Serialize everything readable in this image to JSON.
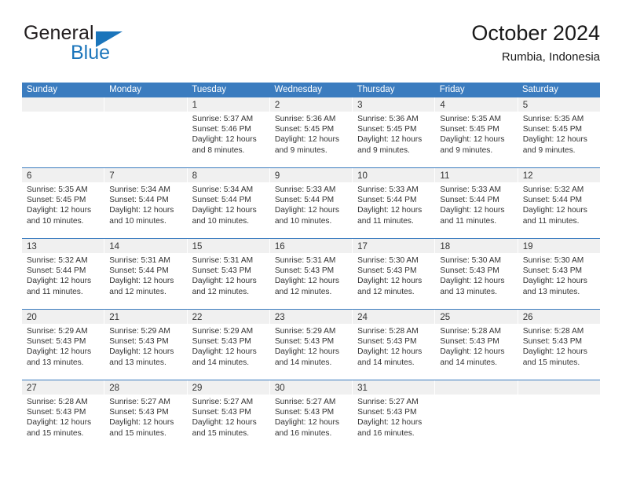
{
  "brand": {
    "name_top": "General",
    "name_bottom": "Blue",
    "triangle_icon": "triangle-icon",
    "color_blue": "#1b75bb",
    "color_dark": "#231f20"
  },
  "header": {
    "title": "October 2024",
    "subtitle": "Rumbia, Indonesia"
  },
  "theme": {
    "header_bg": "#3b7cbf",
    "header_text": "#ffffff",
    "day_band_bg": "#f0f0f0",
    "body_text": "#333333"
  },
  "weekdays": [
    "Sunday",
    "Monday",
    "Tuesday",
    "Wednesday",
    "Thursday",
    "Friday",
    "Saturday"
  ],
  "weeks": [
    [
      {
        "day": "",
        "sunrise": "",
        "sunset": "",
        "daylight_line1": "",
        "daylight_line2": ""
      },
      {
        "day": "",
        "sunrise": "",
        "sunset": "",
        "daylight_line1": "",
        "daylight_line2": ""
      },
      {
        "day": "1",
        "sunrise": "Sunrise: 5:37 AM",
        "sunset": "Sunset: 5:46 PM",
        "daylight_line1": "Daylight: 12 hours",
        "daylight_line2": "and 8 minutes."
      },
      {
        "day": "2",
        "sunrise": "Sunrise: 5:36 AM",
        "sunset": "Sunset: 5:45 PM",
        "daylight_line1": "Daylight: 12 hours",
        "daylight_line2": "and 9 minutes."
      },
      {
        "day": "3",
        "sunrise": "Sunrise: 5:36 AM",
        "sunset": "Sunset: 5:45 PM",
        "daylight_line1": "Daylight: 12 hours",
        "daylight_line2": "and 9 minutes."
      },
      {
        "day": "4",
        "sunrise": "Sunrise: 5:35 AM",
        "sunset": "Sunset: 5:45 PM",
        "daylight_line1": "Daylight: 12 hours",
        "daylight_line2": "and 9 minutes."
      },
      {
        "day": "5",
        "sunrise": "Sunrise: 5:35 AM",
        "sunset": "Sunset: 5:45 PM",
        "daylight_line1": "Daylight: 12 hours",
        "daylight_line2": "and 9 minutes."
      }
    ],
    [
      {
        "day": "6",
        "sunrise": "Sunrise: 5:35 AM",
        "sunset": "Sunset: 5:45 PM",
        "daylight_line1": "Daylight: 12 hours",
        "daylight_line2": "and 10 minutes."
      },
      {
        "day": "7",
        "sunrise": "Sunrise: 5:34 AM",
        "sunset": "Sunset: 5:44 PM",
        "daylight_line1": "Daylight: 12 hours",
        "daylight_line2": "and 10 minutes."
      },
      {
        "day": "8",
        "sunrise": "Sunrise: 5:34 AM",
        "sunset": "Sunset: 5:44 PM",
        "daylight_line1": "Daylight: 12 hours",
        "daylight_line2": "and 10 minutes."
      },
      {
        "day": "9",
        "sunrise": "Sunrise: 5:33 AM",
        "sunset": "Sunset: 5:44 PM",
        "daylight_line1": "Daylight: 12 hours",
        "daylight_line2": "and 10 minutes."
      },
      {
        "day": "10",
        "sunrise": "Sunrise: 5:33 AM",
        "sunset": "Sunset: 5:44 PM",
        "daylight_line1": "Daylight: 12 hours",
        "daylight_line2": "and 11 minutes."
      },
      {
        "day": "11",
        "sunrise": "Sunrise: 5:33 AM",
        "sunset": "Sunset: 5:44 PM",
        "daylight_line1": "Daylight: 12 hours",
        "daylight_line2": "and 11 minutes."
      },
      {
        "day": "12",
        "sunrise": "Sunrise: 5:32 AM",
        "sunset": "Sunset: 5:44 PM",
        "daylight_line1": "Daylight: 12 hours",
        "daylight_line2": "and 11 minutes."
      }
    ],
    [
      {
        "day": "13",
        "sunrise": "Sunrise: 5:32 AM",
        "sunset": "Sunset: 5:44 PM",
        "daylight_line1": "Daylight: 12 hours",
        "daylight_line2": "and 11 minutes."
      },
      {
        "day": "14",
        "sunrise": "Sunrise: 5:31 AM",
        "sunset": "Sunset: 5:44 PM",
        "daylight_line1": "Daylight: 12 hours",
        "daylight_line2": "and 12 minutes."
      },
      {
        "day": "15",
        "sunrise": "Sunrise: 5:31 AM",
        "sunset": "Sunset: 5:43 PM",
        "daylight_line1": "Daylight: 12 hours",
        "daylight_line2": "and 12 minutes."
      },
      {
        "day": "16",
        "sunrise": "Sunrise: 5:31 AM",
        "sunset": "Sunset: 5:43 PM",
        "daylight_line1": "Daylight: 12 hours",
        "daylight_line2": "and 12 minutes."
      },
      {
        "day": "17",
        "sunrise": "Sunrise: 5:30 AM",
        "sunset": "Sunset: 5:43 PM",
        "daylight_line1": "Daylight: 12 hours",
        "daylight_line2": "and 12 minutes."
      },
      {
        "day": "18",
        "sunrise": "Sunrise: 5:30 AM",
        "sunset": "Sunset: 5:43 PM",
        "daylight_line1": "Daylight: 12 hours",
        "daylight_line2": "and 13 minutes."
      },
      {
        "day": "19",
        "sunrise": "Sunrise: 5:30 AM",
        "sunset": "Sunset: 5:43 PM",
        "daylight_line1": "Daylight: 12 hours",
        "daylight_line2": "and 13 minutes."
      }
    ],
    [
      {
        "day": "20",
        "sunrise": "Sunrise: 5:29 AM",
        "sunset": "Sunset: 5:43 PM",
        "daylight_line1": "Daylight: 12 hours",
        "daylight_line2": "and 13 minutes."
      },
      {
        "day": "21",
        "sunrise": "Sunrise: 5:29 AM",
        "sunset": "Sunset: 5:43 PM",
        "daylight_line1": "Daylight: 12 hours",
        "daylight_line2": "and 13 minutes."
      },
      {
        "day": "22",
        "sunrise": "Sunrise: 5:29 AM",
        "sunset": "Sunset: 5:43 PM",
        "daylight_line1": "Daylight: 12 hours",
        "daylight_line2": "and 14 minutes."
      },
      {
        "day": "23",
        "sunrise": "Sunrise: 5:29 AM",
        "sunset": "Sunset: 5:43 PM",
        "daylight_line1": "Daylight: 12 hours",
        "daylight_line2": "and 14 minutes."
      },
      {
        "day": "24",
        "sunrise": "Sunrise: 5:28 AM",
        "sunset": "Sunset: 5:43 PM",
        "daylight_line1": "Daylight: 12 hours",
        "daylight_line2": "and 14 minutes."
      },
      {
        "day": "25",
        "sunrise": "Sunrise: 5:28 AM",
        "sunset": "Sunset: 5:43 PM",
        "daylight_line1": "Daylight: 12 hours",
        "daylight_line2": "and 14 minutes."
      },
      {
        "day": "26",
        "sunrise": "Sunrise: 5:28 AM",
        "sunset": "Sunset: 5:43 PM",
        "daylight_line1": "Daylight: 12 hours",
        "daylight_line2": "and 15 minutes."
      }
    ],
    [
      {
        "day": "27",
        "sunrise": "Sunrise: 5:28 AM",
        "sunset": "Sunset: 5:43 PM",
        "daylight_line1": "Daylight: 12 hours",
        "daylight_line2": "and 15 minutes."
      },
      {
        "day": "28",
        "sunrise": "Sunrise: 5:27 AM",
        "sunset": "Sunset: 5:43 PM",
        "daylight_line1": "Daylight: 12 hours",
        "daylight_line2": "and 15 minutes."
      },
      {
        "day": "29",
        "sunrise": "Sunrise: 5:27 AM",
        "sunset": "Sunset: 5:43 PM",
        "daylight_line1": "Daylight: 12 hours",
        "daylight_line2": "and 15 minutes."
      },
      {
        "day": "30",
        "sunrise": "Sunrise: 5:27 AM",
        "sunset": "Sunset: 5:43 PM",
        "daylight_line1": "Daylight: 12 hours",
        "daylight_line2": "and 16 minutes."
      },
      {
        "day": "31",
        "sunrise": "Sunrise: 5:27 AM",
        "sunset": "Sunset: 5:43 PM",
        "daylight_line1": "Daylight: 12 hours",
        "daylight_line2": "and 16 minutes."
      },
      {
        "day": "",
        "sunrise": "",
        "sunset": "",
        "daylight_line1": "",
        "daylight_line2": ""
      },
      {
        "day": "",
        "sunrise": "",
        "sunset": "",
        "daylight_line1": "",
        "daylight_line2": ""
      }
    ]
  ]
}
